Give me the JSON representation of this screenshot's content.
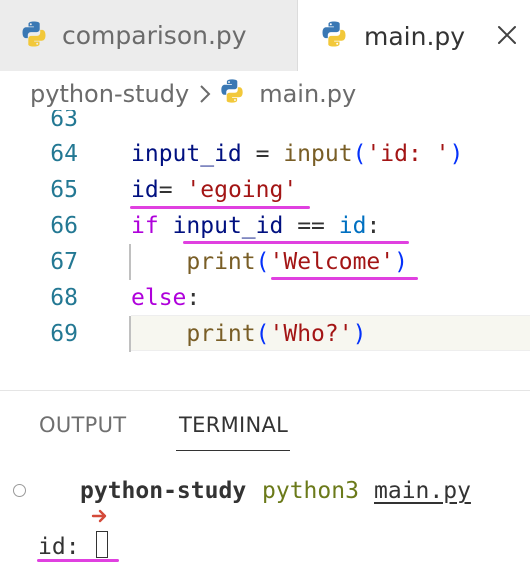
{
  "tabs": [
    {
      "label": "comparison.py",
      "icon": "python-icon",
      "active": false
    },
    {
      "label": "main.py",
      "icon": "python-icon",
      "active": true
    }
  ],
  "tab_close_icon": "close-icon",
  "breadcrumb": {
    "folder": "python-study",
    "separator_icon": "chevron-right-icon",
    "file_icon": "python-icon",
    "file": "main.py"
  },
  "editor": {
    "lines": [
      {
        "number": "63",
        "tokens": []
      },
      {
        "number": "64",
        "tokens": [
          {
            "t": "input_id",
            "c": "var"
          },
          {
            "t": " = ",
            "c": "op"
          },
          {
            "t": "input",
            "c": "fn"
          },
          {
            "t": "(",
            "c": "pun"
          },
          {
            "t": "'id: '",
            "c": "str"
          },
          {
            "t": ")",
            "c": "pun"
          }
        ]
      },
      {
        "number": "65",
        "tokens": [
          {
            "t": "id",
            "c": "var"
          },
          {
            "t": "= ",
            "c": "op"
          },
          {
            "t": "'egoing'",
            "c": "str"
          }
        ]
      },
      {
        "number": "66",
        "tokens": [
          {
            "t": "if",
            "c": "kw"
          },
          {
            "t": " ",
            "c": "op"
          },
          {
            "t": "input_id",
            "c": "var"
          },
          {
            "t": " == ",
            "c": "op"
          },
          {
            "t": "id",
            "c": "id"
          },
          {
            "t": ":",
            "c": "plain"
          }
        ]
      },
      {
        "number": "67",
        "tokens": [
          {
            "t": "    ",
            "c": "op"
          },
          {
            "t": "print",
            "c": "fn"
          },
          {
            "t": "(",
            "c": "pun"
          },
          {
            "t": "'Welcome'",
            "c": "str"
          },
          {
            "t": ")",
            "c": "pun"
          }
        ]
      },
      {
        "number": "68",
        "tokens": [
          {
            "t": "else",
            "c": "kw"
          },
          {
            "t": ":",
            "c": "plain"
          }
        ]
      },
      {
        "number": "69",
        "tokens": [
          {
            "t": "    ",
            "c": "op"
          },
          {
            "t": "print",
            "c": "fn"
          },
          {
            "t": "(",
            "c": "pun"
          },
          {
            "t": "'Who?'",
            "c": "str"
          },
          {
            "t": ")",
            "c": "pun"
          }
        ]
      }
    ],
    "colors": {
      "line_number": "#237893",
      "variable": "#001080",
      "function": "#795e26",
      "string": "#a31515",
      "keyword": "#af00db",
      "highlight_mark": "#e040e0"
    }
  },
  "panel": {
    "tabs": [
      {
        "label": "OUTPUT",
        "active": false
      },
      {
        "label": "TERMINAL",
        "active": true
      }
    ]
  },
  "terminal": {
    "status_icon": "circle-icon",
    "prompt_icon": "arrow-right-icon",
    "cwd": "python-study",
    "command": "python3",
    "argument": "main.py",
    "input_prompt": "id:"
  }
}
